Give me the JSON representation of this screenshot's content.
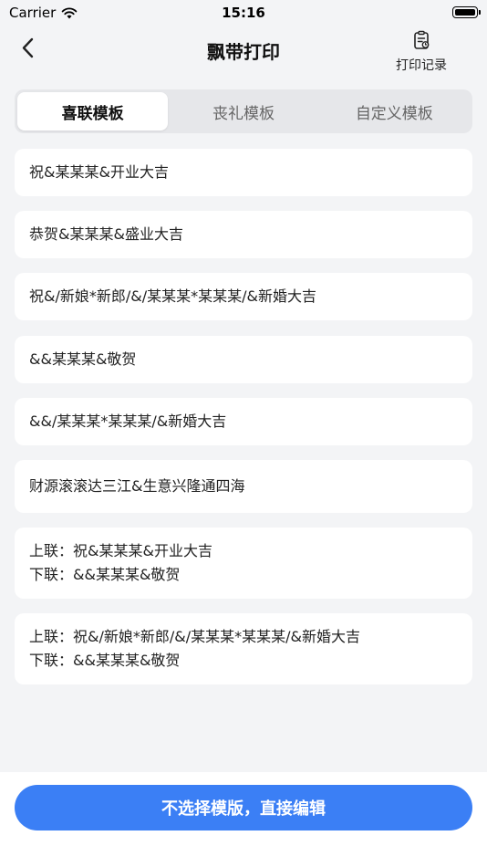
{
  "status_bar": {
    "carrier": "Carrier",
    "time": "15:16"
  },
  "nav": {
    "title": "飘带打印",
    "record_label": "打印记录",
    "icons": {
      "back": "chevron-left-icon",
      "record": "clipboard-list-icon"
    }
  },
  "tabs": [
    {
      "label": "喜联模板",
      "active": true
    },
    {
      "label": "丧礼模板",
      "active": false
    },
    {
      "label": "自定义模板",
      "active": false
    }
  ],
  "templates": [
    {
      "lines": [
        "祝&某某某&开业大吉"
      ]
    },
    {
      "lines": [
        "恭贺&某某某&盛业大吉"
      ]
    },
    {
      "lines": [
        "祝&/新娘*新郎/&/某某某*某某某/&新婚大吉"
      ]
    },
    {
      "lines": [
        "&&某某某&敬贺"
      ]
    },
    {
      "lines": [
        "&&/某某某*某某某/&新婚大吉"
      ]
    },
    {
      "lines": [
        "财源滚滚达三江&生意兴隆通四海"
      ]
    },
    {
      "lines": [
        "上联：祝&某某某&开业大吉",
        "下联：&&某某某&敬贺"
      ]
    },
    {
      "lines": [
        "上联：祝&/新娘*新郎/&/某某某*某某某/&新婚大吉",
        "下联：&&某某某&敬贺"
      ]
    }
  ],
  "bottom": {
    "button_label": "不选择模版，直接编辑"
  },
  "colors": {
    "accent": "#3b7ff5",
    "background": "#f3f4f6"
  }
}
